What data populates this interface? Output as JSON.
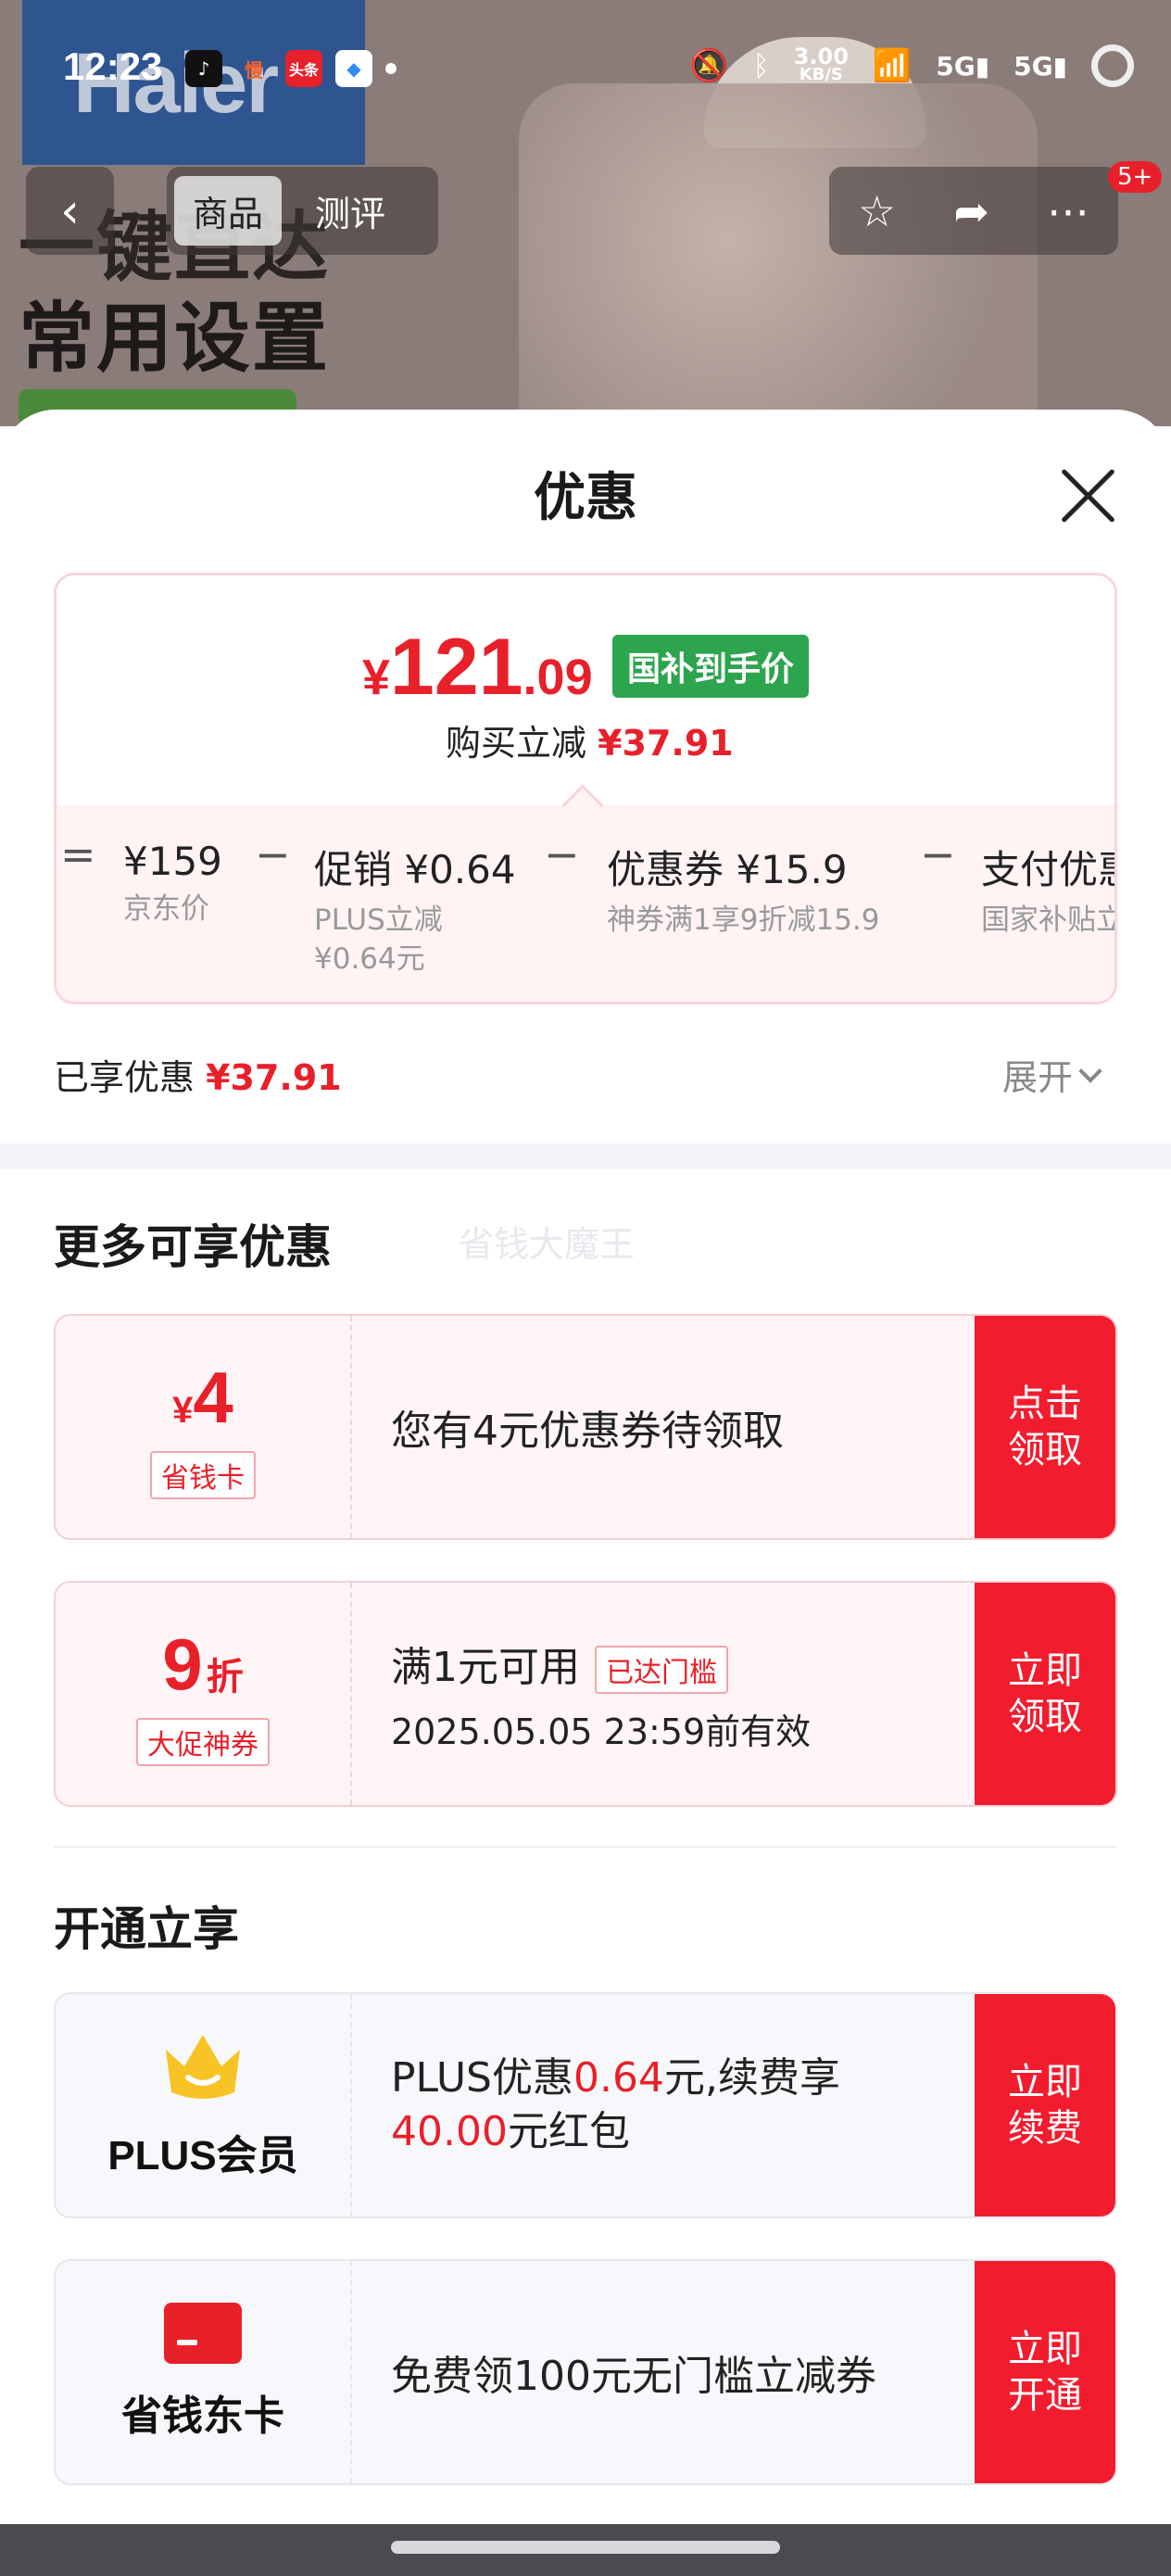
{
  "status_bar": {
    "time": "12:23",
    "apps": [
      {
        "icon": "tiktok-icon",
        "glyph": "♪",
        "color": "#111111"
      },
      {
        "icon": "manga-app-icon",
        "glyph": "慢",
        "color": "#f2622b"
      },
      {
        "icon": "toutiao-icon",
        "glyph": "头条",
        "color": "#e8202a"
      },
      {
        "icon": "browser-icon",
        "glyph": "◆",
        "color": "#2f8cf0"
      }
    ],
    "speed_top": "3.00",
    "speed_bottom": "KB/S"
  },
  "nav": {
    "tabs": [
      "商品",
      "测评"
    ],
    "badge": "5+"
  },
  "background": {
    "brand": "Haier",
    "line1": "一键直达",
    "line2": "常用设置"
  },
  "sheet": {
    "title": "优惠",
    "price": {
      "currency": "¥",
      "integer": "121",
      "decimal": ".09"
    },
    "price_tag": "国补到手价",
    "instant_discount_label": "购买立减",
    "instant_discount_value": "¥37.91",
    "breakdown": [
      {
        "op": "=",
        "main": "¥159",
        "note": "京东价"
      },
      {
        "op": "−",
        "main": "促销 ¥0.64",
        "note": "PLUS立减\n¥0.64元"
      },
      {
        "op": "−",
        "main": "优惠券 ¥15.9",
        "note": "神券满1享9折减15.9"
      },
      {
        "op": "−",
        "main": "支付优惠",
        "note": "国家补贴立"
      }
    ],
    "enjoyed_label": "已享优惠",
    "enjoyed_value": "¥37.91",
    "expand_label": "展开"
  },
  "more": {
    "title": "更多可享优惠",
    "watermark": "省钱大魔王",
    "coupons": [
      {
        "amount_currency": "¥",
        "amount": "4",
        "chip": "省钱卡",
        "text": "您有4元优惠券待领取",
        "button": "点击\n领取"
      },
      {
        "amount": "9",
        "unit": "折",
        "chip": "大促神券",
        "text": "满1元可用",
        "reached": "已达门槛",
        "sub": "2025.05.05 23:59前有效",
        "button": "立即\n领取"
      }
    ]
  },
  "open": {
    "title": "开通立享",
    "plus": {
      "label": "PLUS会员",
      "t1": "PLUS优惠",
      "t2": "0.64",
      "t3": "元,续费享",
      "t4": "40.00",
      "t5": "元红包",
      "button": "立即\n续费",
      "icon": "crown-icon"
    },
    "card": {
      "label": "省钱东卡",
      "text": "免费领100元无门槛立减券",
      "button": "立即\n开通",
      "icon": "red-card-icon"
    }
  },
  "colors": {
    "accent": "#e8202a",
    "button": "#f21c2f",
    "tag_green": "#2da44e",
    "crown": "#f7c325"
  }
}
